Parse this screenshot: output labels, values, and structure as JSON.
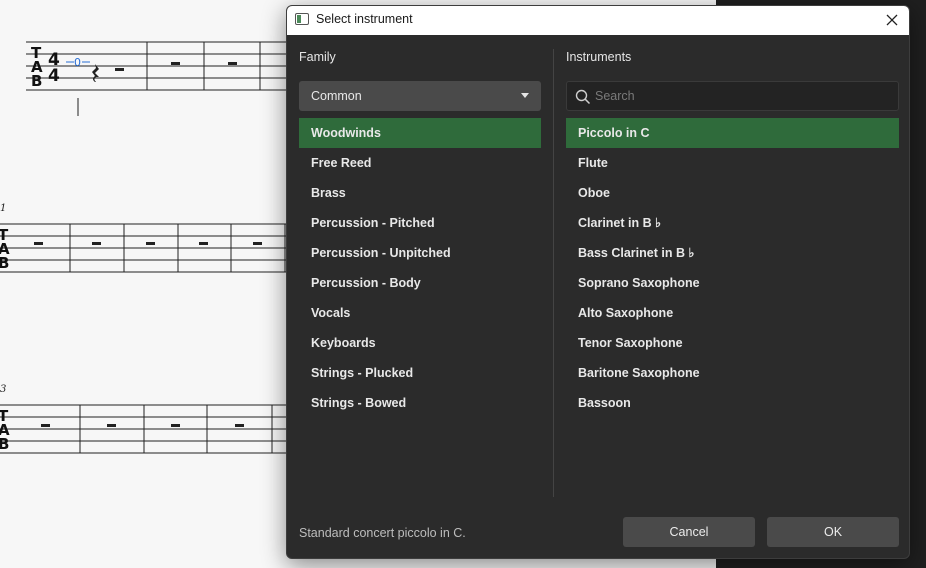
{
  "score": {
    "measure_numbers": [
      "1",
      "3"
    ],
    "tab_clef": [
      "T",
      "A",
      "B"
    ],
    "time_signature": [
      "4",
      "4"
    ],
    "fret_number": "0"
  },
  "dialog": {
    "title": "Select instrument",
    "family_label": "Family",
    "instruments_label": "Instruments",
    "family_dropdown_value": "Common",
    "search_placeholder": "Search",
    "search_value": "",
    "families": [
      "Woodwinds",
      "Free Reed",
      "Brass",
      "Percussion - Pitched",
      "Percussion - Unpitched",
      "Percussion - Body",
      "Vocals",
      "Keyboards",
      "Strings - Plucked",
      "Strings - Bowed"
    ],
    "selected_family": "Woodwinds",
    "instruments": [
      "Piccolo in C",
      "Flute",
      "Oboe",
      "Clarinet in B ♭",
      "Bass Clarinet in B ♭",
      "Soprano Saxophone",
      "Alto Saxophone",
      "Tenor Saxophone",
      "Baritone Saxophone",
      "Bassoon"
    ],
    "selected_instrument": "Piccolo in C",
    "description": "Standard concert piccolo in C.",
    "cancel_label": "Cancel",
    "ok_label": "OK"
  },
  "colors": {
    "accent_selected": "#2f6b3b",
    "dialog_bg": "#2b2b2b",
    "button_bg": "#4a4a4a"
  },
  "icons": [
    "app-window-icon",
    "close-icon",
    "search-icon",
    "chevron-down-icon"
  ]
}
